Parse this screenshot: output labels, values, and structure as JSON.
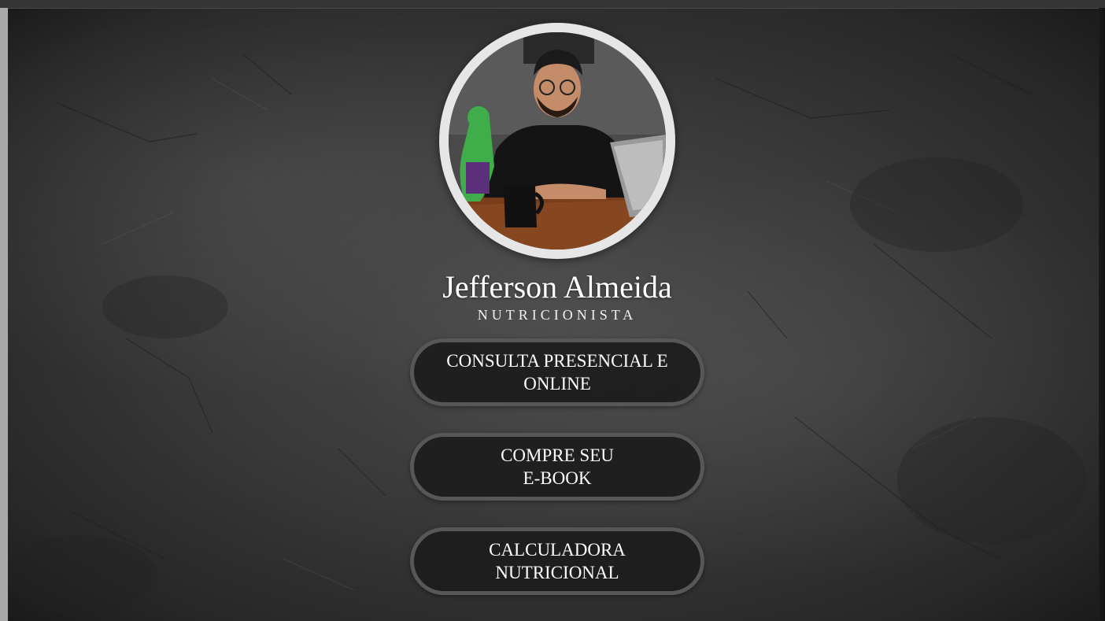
{
  "profile": {
    "name": "Jefferson Almeida",
    "title": "NUTRICIONISTA",
    "photo": "profile-photo"
  },
  "links": [
    {
      "label": "CONSULTA PRESENCIAL E ONLINE"
    },
    {
      "label": "COMPRE SEU\nE-BOOK"
    },
    {
      "label": "CALCULADORA NUTRICIONAL"
    }
  ],
  "colors": {
    "background": "#3a3a3a",
    "ring": "#e6e6e6",
    "button_fill": "#1c1c1c",
    "button_border": "#575757",
    "text": "#ffffff"
  }
}
